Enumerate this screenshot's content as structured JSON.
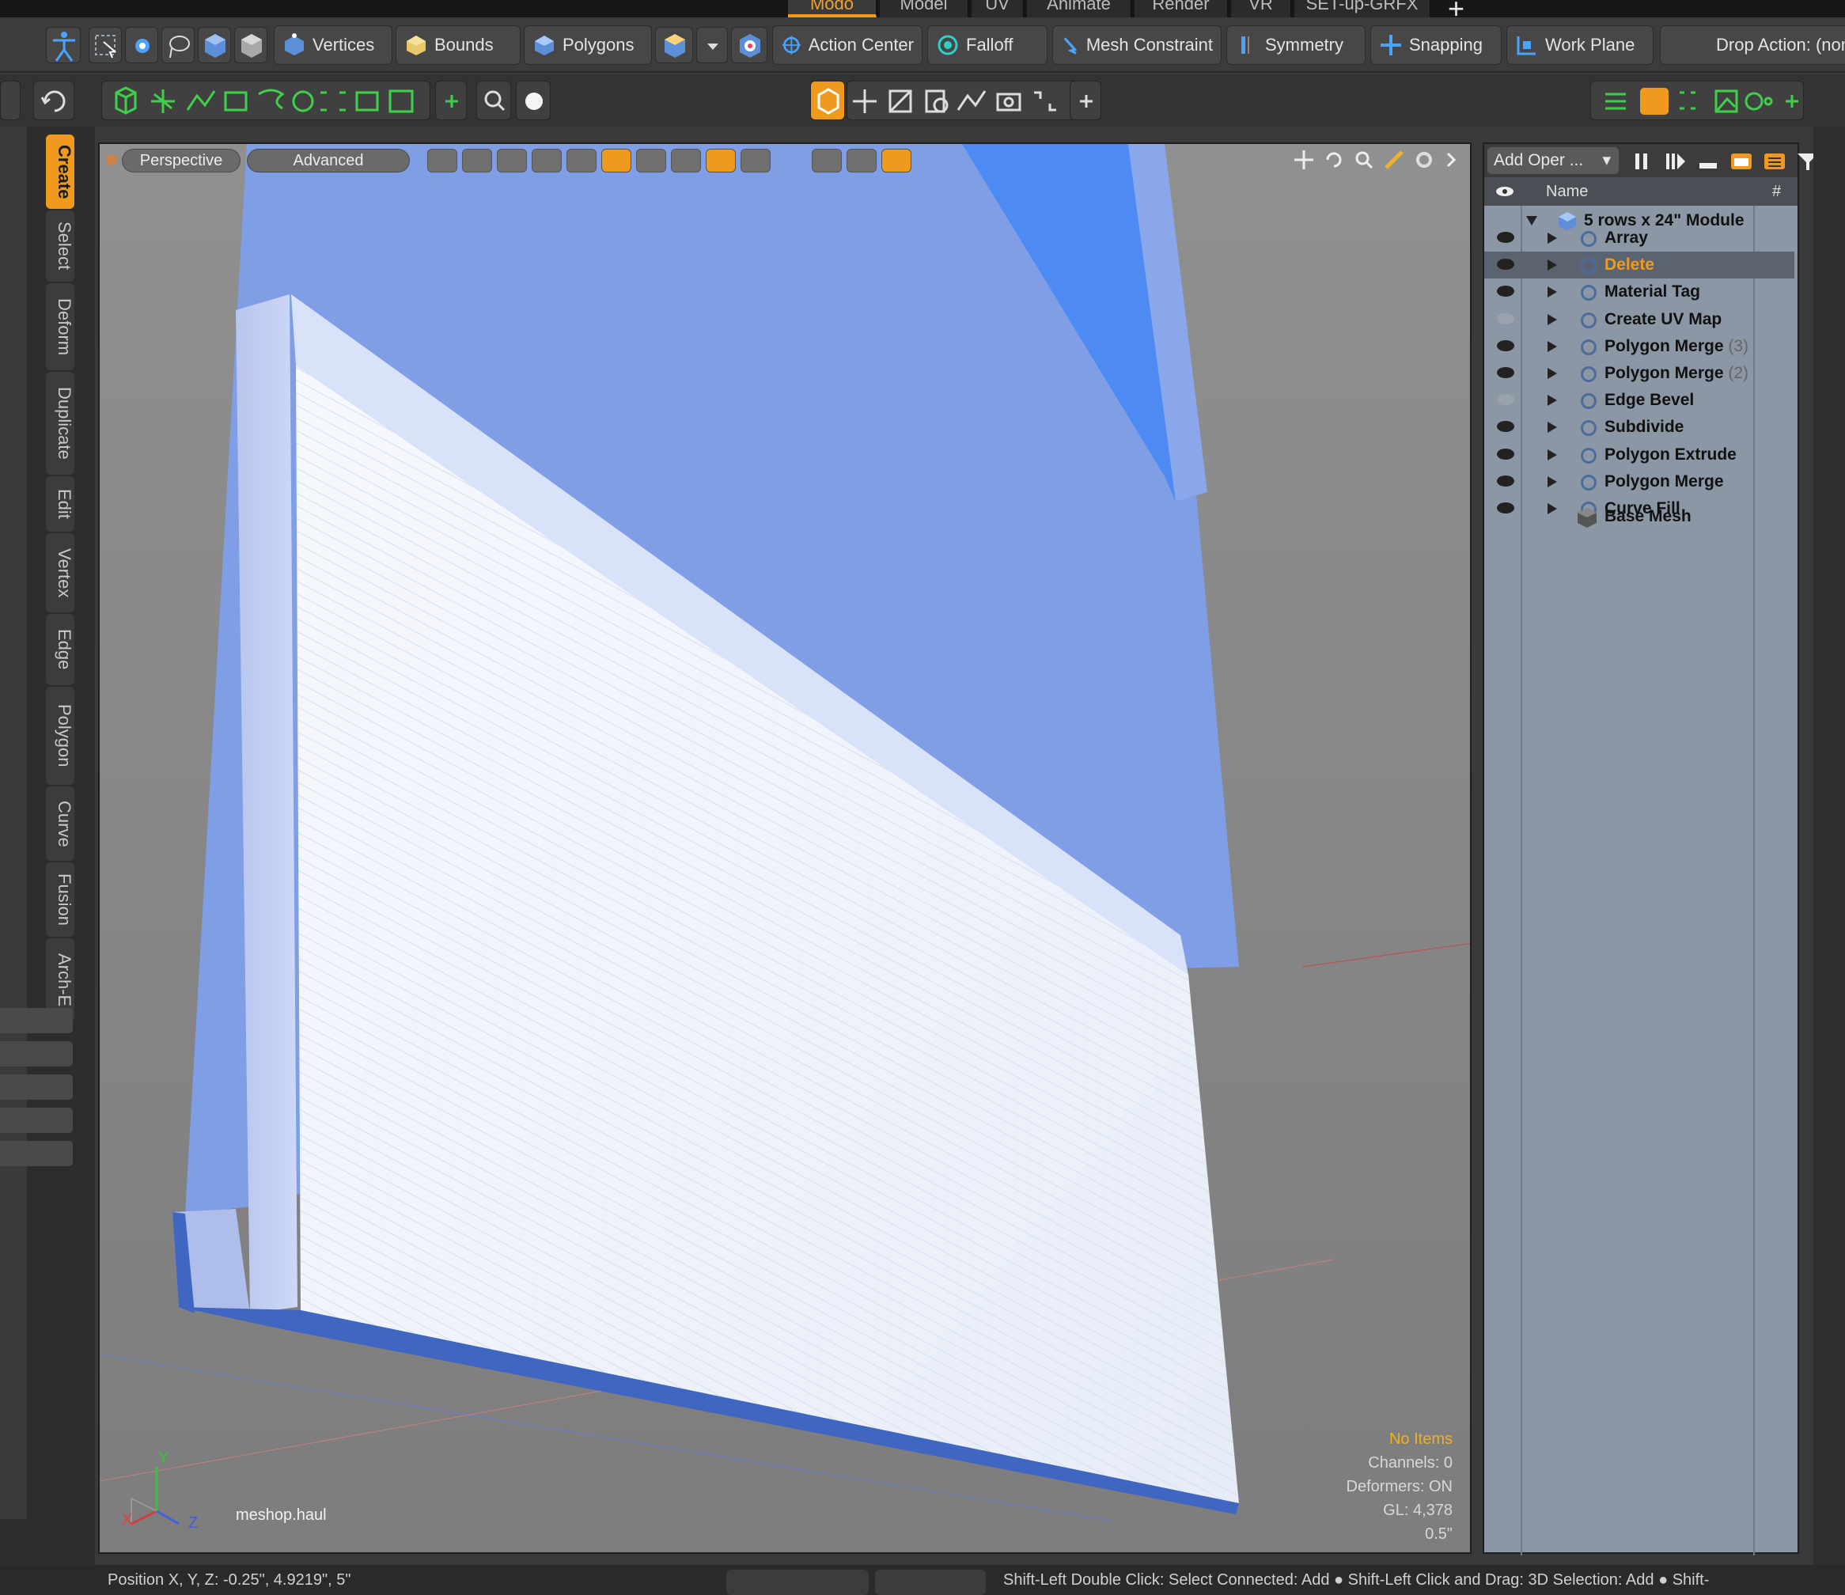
{
  "tabs": [
    {
      "label": "Modo",
      "active": true
    },
    {
      "label": "Model",
      "active": false
    },
    {
      "label": "UV",
      "active": false
    },
    {
      "label": "Animate",
      "active": false
    },
    {
      "label": "Render",
      "active": false
    },
    {
      "label": "VR",
      "active": false
    },
    {
      "label": "SET-up-GRFX",
      "active": false
    }
  ],
  "tab_add": "+",
  "toolbar": {
    "vertices": "Vertices",
    "bounds": "Bounds",
    "polygons": "Polygons",
    "action_center": "Action Center",
    "falloff": "Falloff",
    "mesh_constraint": "Mesh Constraint",
    "symmetry": "Symmetry",
    "snapping": "Snapping",
    "work_plane": "Work Plane",
    "drop_action": "Drop Action: (non"
  },
  "left_tabs": [
    "Create",
    "Select",
    "Deform",
    "Duplicate",
    "Edit",
    "Vertex",
    "Edge",
    "Polygon",
    "Curve",
    "Fusion",
    "Arch-E"
  ],
  "viewport": {
    "view_mode": "Perspective",
    "shading_mode": "Advanced",
    "watermark": "meshop.haul",
    "no_items": "No Items",
    "channels": "Channels: 0",
    "deformers": "Deformers: ON",
    "gl": "GL: 4,378",
    "grid_size": "0.5\"",
    "axis_x": "X",
    "axis_y": "Y",
    "axis_z": "Z"
  },
  "mesh_ops": {
    "add_operator": "Add Oper ...",
    "col_name": "Name",
    "col_count": "#",
    "root": "5 rows x 24\" Module",
    "items": [
      {
        "label": "Array",
        "count": "",
        "visible": true,
        "selected": false
      },
      {
        "label": "Delete",
        "count": "",
        "visible": true,
        "selected": true
      },
      {
        "label": "Material Tag",
        "count": "",
        "visible": true,
        "selected": false
      },
      {
        "label": "Create UV Map",
        "count": "",
        "visible": false,
        "selected": false
      },
      {
        "label": "Polygon Merge",
        "count": "(3)",
        "visible": true,
        "selected": false
      },
      {
        "label": "Polygon Merge",
        "count": "(2)",
        "visible": true,
        "selected": false
      },
      {
        "label": "Edge Bevel",
        "count": "",
        "visible": false,
        "selected": false
      },
      {
        "label": "Subdivide",
        "count": "",
        "visible": true,
        "selected": false
      },
      {
        "label": "Polygon Extrude",
        "count": "",
        "visible": true,
        "selected": false
      },
      {
        "label": "Polygon Merge",
        "count": "",
        "visible": true,
        "selected": false
      },
      {
        "label": "Curve Fill",
        "count": "",
        "visible": true,
        "selected": false
      }
    ],
    "base_mesh": "Base Mesh"
  },
  "status": {
    "position": "Position X, Y, Z:  -0.25\", 4.9219\", 5\"",
    "hint": "Shift-Left Double Click: Select Connected: Add ●  Shift-Left Click and Drag: 3D Selection: Add ●  Shift-"
  },
  "colors": {
    "accent": "#f29b19",
    "panel": "#8b97a4",
    "viewport_bg": "#8b8b8b",
    "mesh_blue": "#7f9ee6",
    "mesh_white": "#eef2fb"
  }
}
